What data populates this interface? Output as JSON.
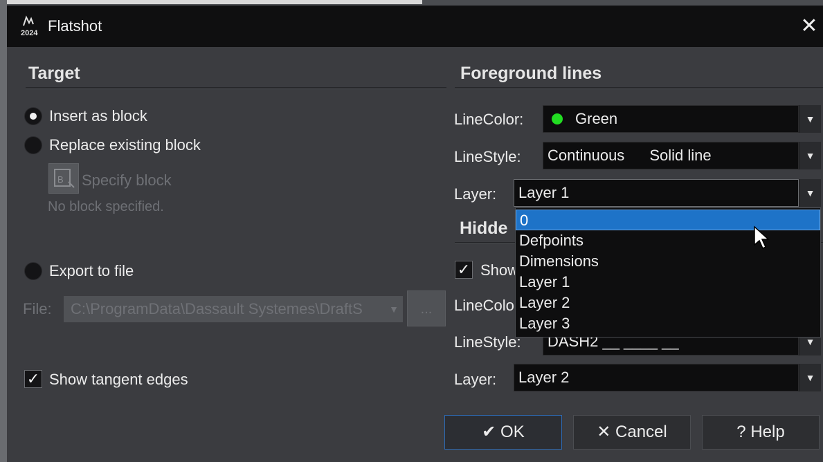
{
  "window": {
    "title": "Flatshot",
    "app_icon": "draftsight-2024-icon",
    "close_icon": "close-icon",
    "app_icon_text": "2024"
  },
  "target": {
    "heading": "Target",
    "insert_as_block": "Insert as block",
    "replace_existing_block": "Replace existing block",
    "specify_block": "Specify block",
    "no_block_specified": "No block specified.",
    "export_to_file": "Export to file",
    "file_label": "File:",
    "file_path": "C:\\ProgramData\\Dassault Systemes\\DraftS",
    "browse_label": "...",
    "show_tangent_edges": "Show tangent edges",
    "selected_option": "Insert as block",
    "show_tangent_edges_checked": true
  },
  "foreground": {
    "heading": "Foreground lines",
    "linecolor_label": "LineColor:",
    "linecolor_value": "Green",
    "linecolor_swatch": "#22dd22",
    "linestyle_label": "LineStyle:",
    "linestyle_value": "Continuous",
    "linestyle_desc": "Solid line",
    "layer_label": "Layer:",
    "layer_value": "Layer 1"
  },
  "hidden": {
    "heading_partial": "Hidde",
    "show_partial": "Show",
    "show_checked": true,
    "linecolor_partial": "LineColo",
    "linestyle_label": "LineStyle:",
    "linestyle_value": "DASH2 __  ____  __",
    "layer_label": "Layer:",
    "layer_value": "Layer 2"
  },
  "layer_dropdown": {
    "options": [
      "0",
      "Defpoints",
      "Dimensions",
      "Layer 1",
      "Layer 2",
      "Layer 3"
    ],
    "highlighted": "0"
  },
  "buttons": {
    "ok": "OK",
    "cancel": "Cancel",
    "help": "Help",
    "ok_icon": "✔",
    "cancel_icon": "✕",
    "help_icon": "?"
  },
  "colors": {
    "accent": "#1e73c8",
    "titlebar": "#0f0f10",
    "panel": "#3b3c40"
  }
}
